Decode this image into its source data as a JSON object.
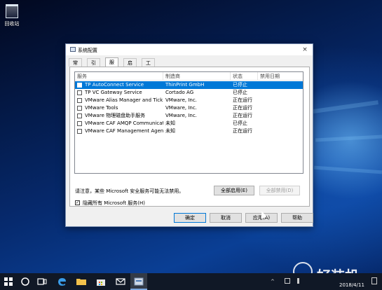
{
  "desktop": {
    "recycle_bin_label": "回收站"
  },
  "dialog": {
    "title": "系统配置",
    "close_glyph": "×",
    "tabs": [
      {
        "label": "常规",
        "active": false
      },
      {
        "label": "引导",
        "active": false
      },
      {
        "label": "服务",
        "active": true
      },
      {
        "label": "启动",
        "active": false
      },
      {
        "label": "工具",
        "active": false
      }
    ],
    "columns": {
      "service": "服务",
      "manufacturer": "制造商",
      "status": "状态",
      "disabled_date": "禁用日期"
    },
    "services": [
      {
        "name": "TP AutoConnect Service",
        "manufacturer": "ThinPrint GmbH",
        "status": "已停止",
        "checked": false,
        "selected": true
      },
      {
        "name": "TP VC Gateway Service",
        "manufacturer": "Cortado AG",
        "status": "已停止",
        "checked": false,
        "selected": false
      },
      {
        "name": "VMware Alias Manager and Tick...",
        "manufacturer": "VMware, Inc.",
        "status": "正在运行",
        "checked": false,
        "selected": false
      },
      {
        "name": "VMware Tools",
        "manufacturer": "VMware, Inc.",
        "status": "正在运行",
        "checked": false,
        "selected": false
      },
      {
        "name": "VMware 物理磁盘助手服务",
        "manufacturer": "VMware, Inc.",
        "status": "正在运行",
        "checked": false,
        "selected": false
      },
      {
        "name": "VMware CAF AMQP Communicat...",
        "manufacturer": "未知",
        "status": "已停止",
        "checked": false,
        "selected": false
      },
      {
        "name": "VMware CAF Management Agent...",
        "manufacturer": "未知",
        "status": "正在运行",
        "checked": false,
        "selected": false
      }
    ],
    "note": "请注意，某些 Microsoft 安全服务可能无法禁用。",
    "enable_all_label": "全部启用(E)",
    "disable_all_label": "全部禁用(D)",
    "hide_ms_label": "隐藏所有 Microsoft 服务(H)",
    "hide_ms_checked": true,
    "hide_ms_check_glyph": "✓",
    "ok_label": "确定",
    "cancel_label": "取消",
    "apply_label": "应用(A)",
    "help_label": "帮助"
  },
  "taskbar": {
    "items": [
      "start-icon",
      "cortana-icon",
      "task-view-icon",
      "edge-icon",
      "file-explorer-icon",
      "store-icon",
      "mail-icon",
      "system-config-icon"
    ],
    "active_item": "system-config-icon",
    "date": "2018/4/11"
  },
  "watermark": {
    "text": "好装机"
  },
  "colors": {
    "selection": "#0078d7",
    "dialog_bg": "#f0f0f0",
    "taskbar": "#101826"
  }
}
